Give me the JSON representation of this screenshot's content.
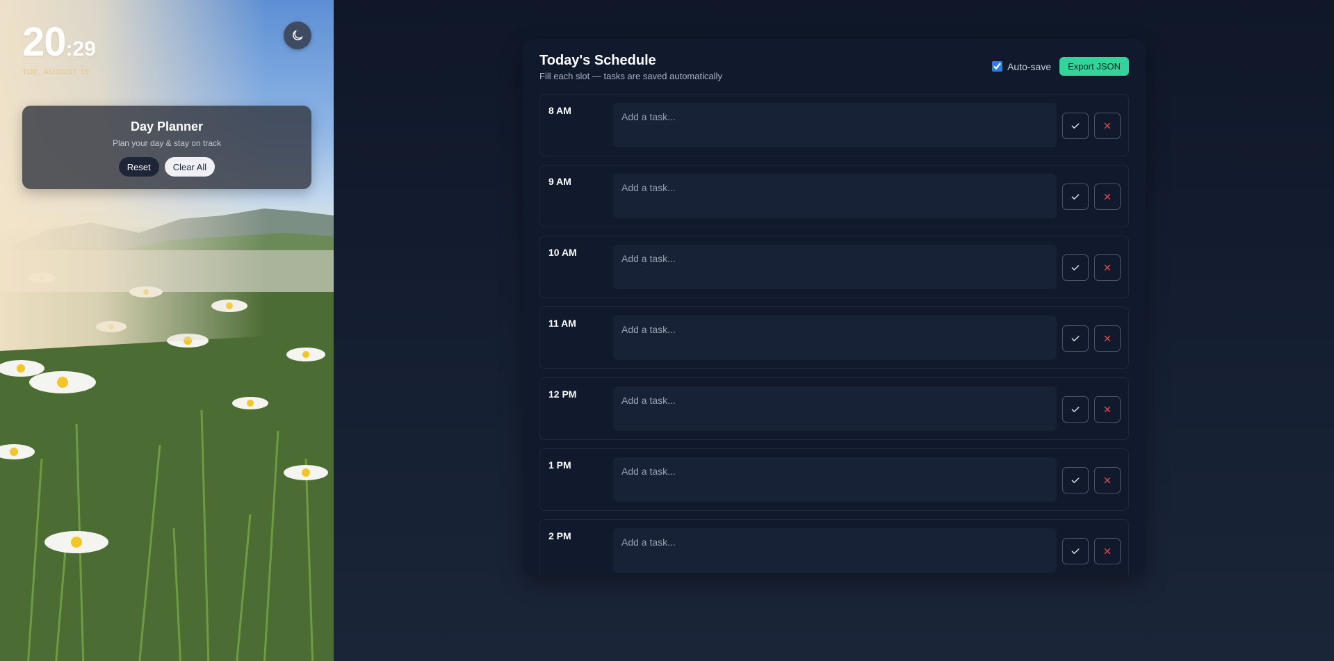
{
  "clock": {
    "hours": "20",
    "minutes": "29",
    "separator": ":",
    "date": "TUE, AUGUST 19"
  },
  "planner": {
    "title": "Day Planner",
    "subtitle": "Plan your day & stay on track",
    "reset_label": "Reset",
    "clear_label": "Clear All"
  },
  "footer": {
    "credit": "Made with ♥ Arup © 2025"
  },
  "theme_toggle": {
    "icon": "moon-icon"
  },
  "schedule": {
    "title": "Today's Schedule",
    "subtitle": "Fill each slot — tasks are saved automatically",
    "autosave_label": "Auto-save",
    "autosave_checked": true,
    "export_label": "Export JSON",
    "slots": [
      {
        "time": "8 AM",
        "placeholder": "Add a task...",
        "value": ""
      },
      {
        "time": "9 AM",
        "placeholder": "Add a task...",
        "value": ""
      },
      {
        "time": "10 AM",
        "placeholder": "Add a task...",
        "value": ""
      },
      {
        "time": "11 AM",
        "placeholder": "Add a task...",
        "value": ""
      },
      {
        "time": "12 PM",
        "placeholder": "Add a task...",
        "value": ""
      },
      {
        "time": "1 PM",
        "placeholder": "Add a task...",
        "value": ""
      },
      {
        "time": "2 PM",
        "placeholder": "Add a task...",
        "value": ""
      }
    ],
    "done_icon": "check-icon",
    "remove_icon": "close-icon"
  },
  "colors": {
    "accent": "#34d399",
    "remove": "#e5484d",
    "panel_bg": "#111a2c",
    "page_bg": "#0f172a"
  }
}
